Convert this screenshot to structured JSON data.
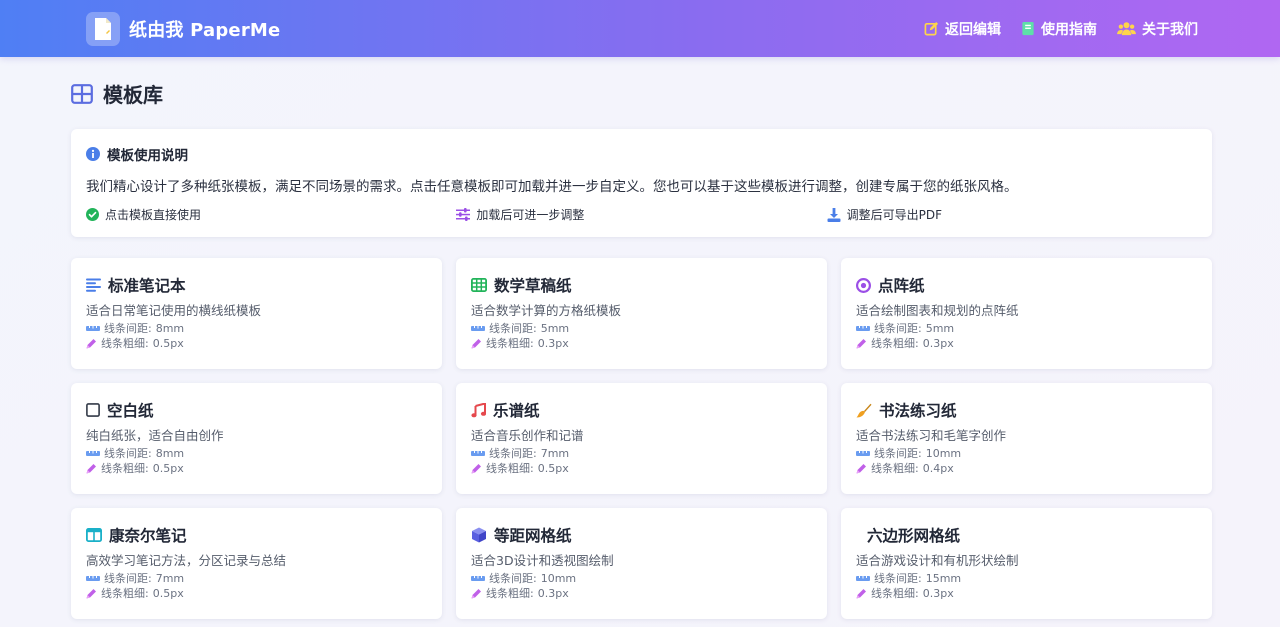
{
  "header": {
    "brand_title": "纸由我 PaperMe",
    "nav": [
      {
        "label": "返回编辑",
        "icon": "edit-icon"
      },
      {
        "label": "使用指南",
        "icon": "book-icon"
      },
      {
        "label": "关于我们",
        "icon": "users-icon"
      }
    ]
  },
  "page": {
    "title": "模板库",
    "icon": "grid-icon"
  },
  "info": {
    "title": "模板使用说明",
    "description": "我们精心设计了多种纸张模板，满足不同场景的需求。点击任意模板即可加载并进一步自定义。您也可以基于这些模板进行调整，创建专属于您的纸张风格。",
    "tips": [
      {
        "label": "点击模板直接使用",
        "icon": "check-circle-icon"
      },
      {
        "label": "加载后可进一步调整",
        "icon": "sliders-icon"
      },
      {
        "label": "调整后可导出PDF",
        "icon": "download-icon"
      }
    ]
  },
  "spec_labels": {
    "spacing": "线条间距: ",
    "thickness": "线条粗细: "
  },
  "templates": [
    {
      "name": "标准笔记本",
      "desc": "适合日常笔记使用的横线纸模板",
      "spacing": "8mm",
      "thickness": "0.5px",
      "icon": "lines-icon",
      "color": "#4a7ee8"
    },
    {
      "name": "数学草稿纸",
      "desc": "适合数学计算的方格纸模板",
      "spacing": "5mm",
      "thickness": "0.3px",
      "icon": "table-grid-icon",
      "color": "#22b45a"
    },
    {
      "name": "点阵纸",
      "desc": "适合绘制图表和规划的点阵纸",
      "spacing": "5mm",
      "thickness": "0.3px",
      "icon": "dot-circle-icon",
      "color": "#9b4fe6"
    },
    {
      "name": "空白纸",
      "desc": "纯白纸张，适合自由创作",
      "spacing": "8mm",
      "thickness": "0.5px",
      "icon": "blank-square-icon",
      "color": "#333a48"
    },
    {
      "name": "乐谱纸",
      "desc": "适合音乐创作和记谱",
      "spacing": "7mm",
      "thickness": "0.5px",
      "icon": "music-note-icon",
      "color": "#e5484d"
    },
    {
      "name": "书法练习纸",
      "desc": "适合书法练习和毛笔字创作",
      "spacing": "10mm",
      "thickness": "0.4px",
      "icon": "brush-icon",
      "color": "#f0a020"
    },
    {
      "name": "康奈尔笔记",
      "desc": "高效学习笔记方法，分区记录与总结",
      "spacing": "7mm",
      "thickness": "0.5px",
      "icon": "columns-icon",
      "color": "#1ab0c8"
    },
    {
      "name": "等距网格纸",
      "desc": "适合3D设计和透视图绘制",
      "spacing": "10mm",
      "thickness": "0.3px",
      "icon": "cube-icon",
      "color": "#5a5fe0"
    },
    {
      "name": "六边形网格纸",
      "desc": "适合游戏设计和有机形状绘制",
      "spacing": "15mm",
      "thickness": "0.3px",
      "icon": "",
      "color": ""
    }
  ]
}
